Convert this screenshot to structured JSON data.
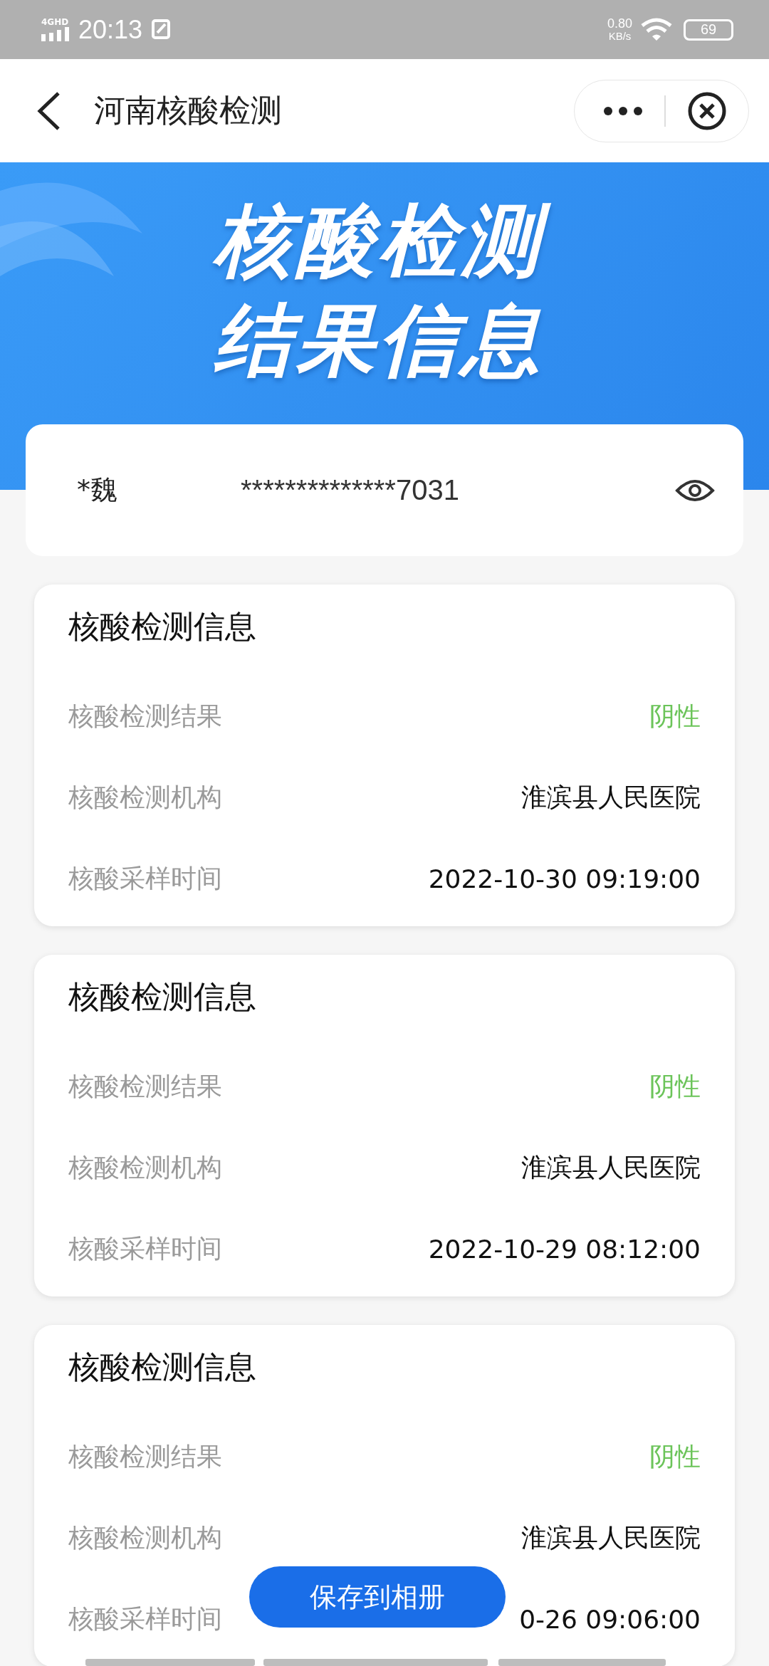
{
  "status_bar": {
    "network": "4GHD",
    "time": "20:13",
    "speed": "0.80",
    "speed_unit": "KB/s",
    "battery": "69"
  },
  "nav": {
    "title": "河南核酸检测"
  },
  "banner": {
    "lines": [
      "核酸检测",
      "结果信息"
    ]
  },
  "identity": {
    "name": "*魏",
    "id_number": "**************7031"
  },
  "records": [
    {
      "title": "核酸检测信息",
      "rows": [
        {
          "label": "核酸检测结果",
          "value": "阴性",
          "kind": "result"
        },
        {
          "label": "核酸检测机构",
          "value": "淮滨县人民医院",
          "kind": "text"
        },
        {
          "label": "核酸采样时间",
          "value": "2022-10-30 09:19:00",
          "kind": "text"
        }
      ]
    },
    {
      "title": "核酸检测信息",
      "rows": [
        {
          "label": "核酸检测结果",
          "value": "阴性",
          "kind": "result"
        },
        {
          "label": "核酸检测机构",
          "value": "淮滨县人民医院",
          "kind": "text"
        },
        {
          "label": "核酸采样时间",
          "value": "2022-10-29 08:12:00",
          "kind": "text"
        }
      ]
    },
    {
      "title": "核酸检测信息",
      "rows": [
        {
          "label": "核酸检测结果",
          "value": "阴性",
          "kind": "result"
        },
        {
          "label": "核酸检测机构",
          "value": "淮滨县人民医院",
          "kind": "text"
        },
        {
          "label": "核酸采样时间",
          "value": "0-26 09:06:00",
          "kind": "text"
        }
      ]
    }
  ],
  "save_button": {
    "label": "保存到相册"
  }
}
